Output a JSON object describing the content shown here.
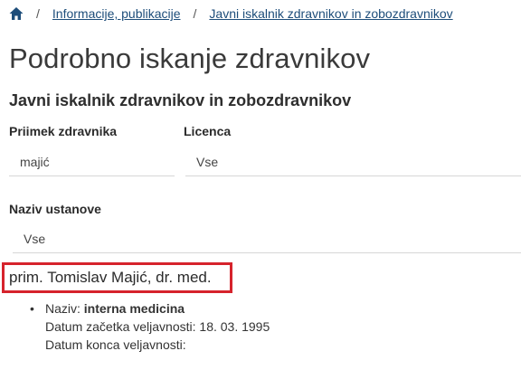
{
  "breadcrumb": {
    "items": [
      "Informacije, publikacije",
      "Javni iskalnik zdravnikov in zobozdravnikov"
    ],
    "separator": "/"
  },
  "page": {
    "title": "Podrobno iskanje zdravnikov",
    "subtitle": "Javni iskalnik zdravnikov in zobozdravnikov"
  },
  "form": {
    "surname_label": "Priimek zdravnika",
    "surname_value": "majić",
    "license_label": "Licenca",
    "license_value": "Vse",
    "institution_label": "Naziv ustanove",
    "institution_value": "Vse"
  },
  "result": {
    "name": "prim. Tomislav Majić, dr. med.",
    "naziv_label": "Naziv:",
    "naziv_value": "interna medicina",
    "start_label": "Datum začetka veljavnosti:",
    "start_value": "18. 03. 1995",
    "end_label": "Datum konca veljavnosti:",
    "end_value": ""
  },
  "colors": {
    "link": "#1d4d7a",
    "highlight": "#d6232c"
  }
}
